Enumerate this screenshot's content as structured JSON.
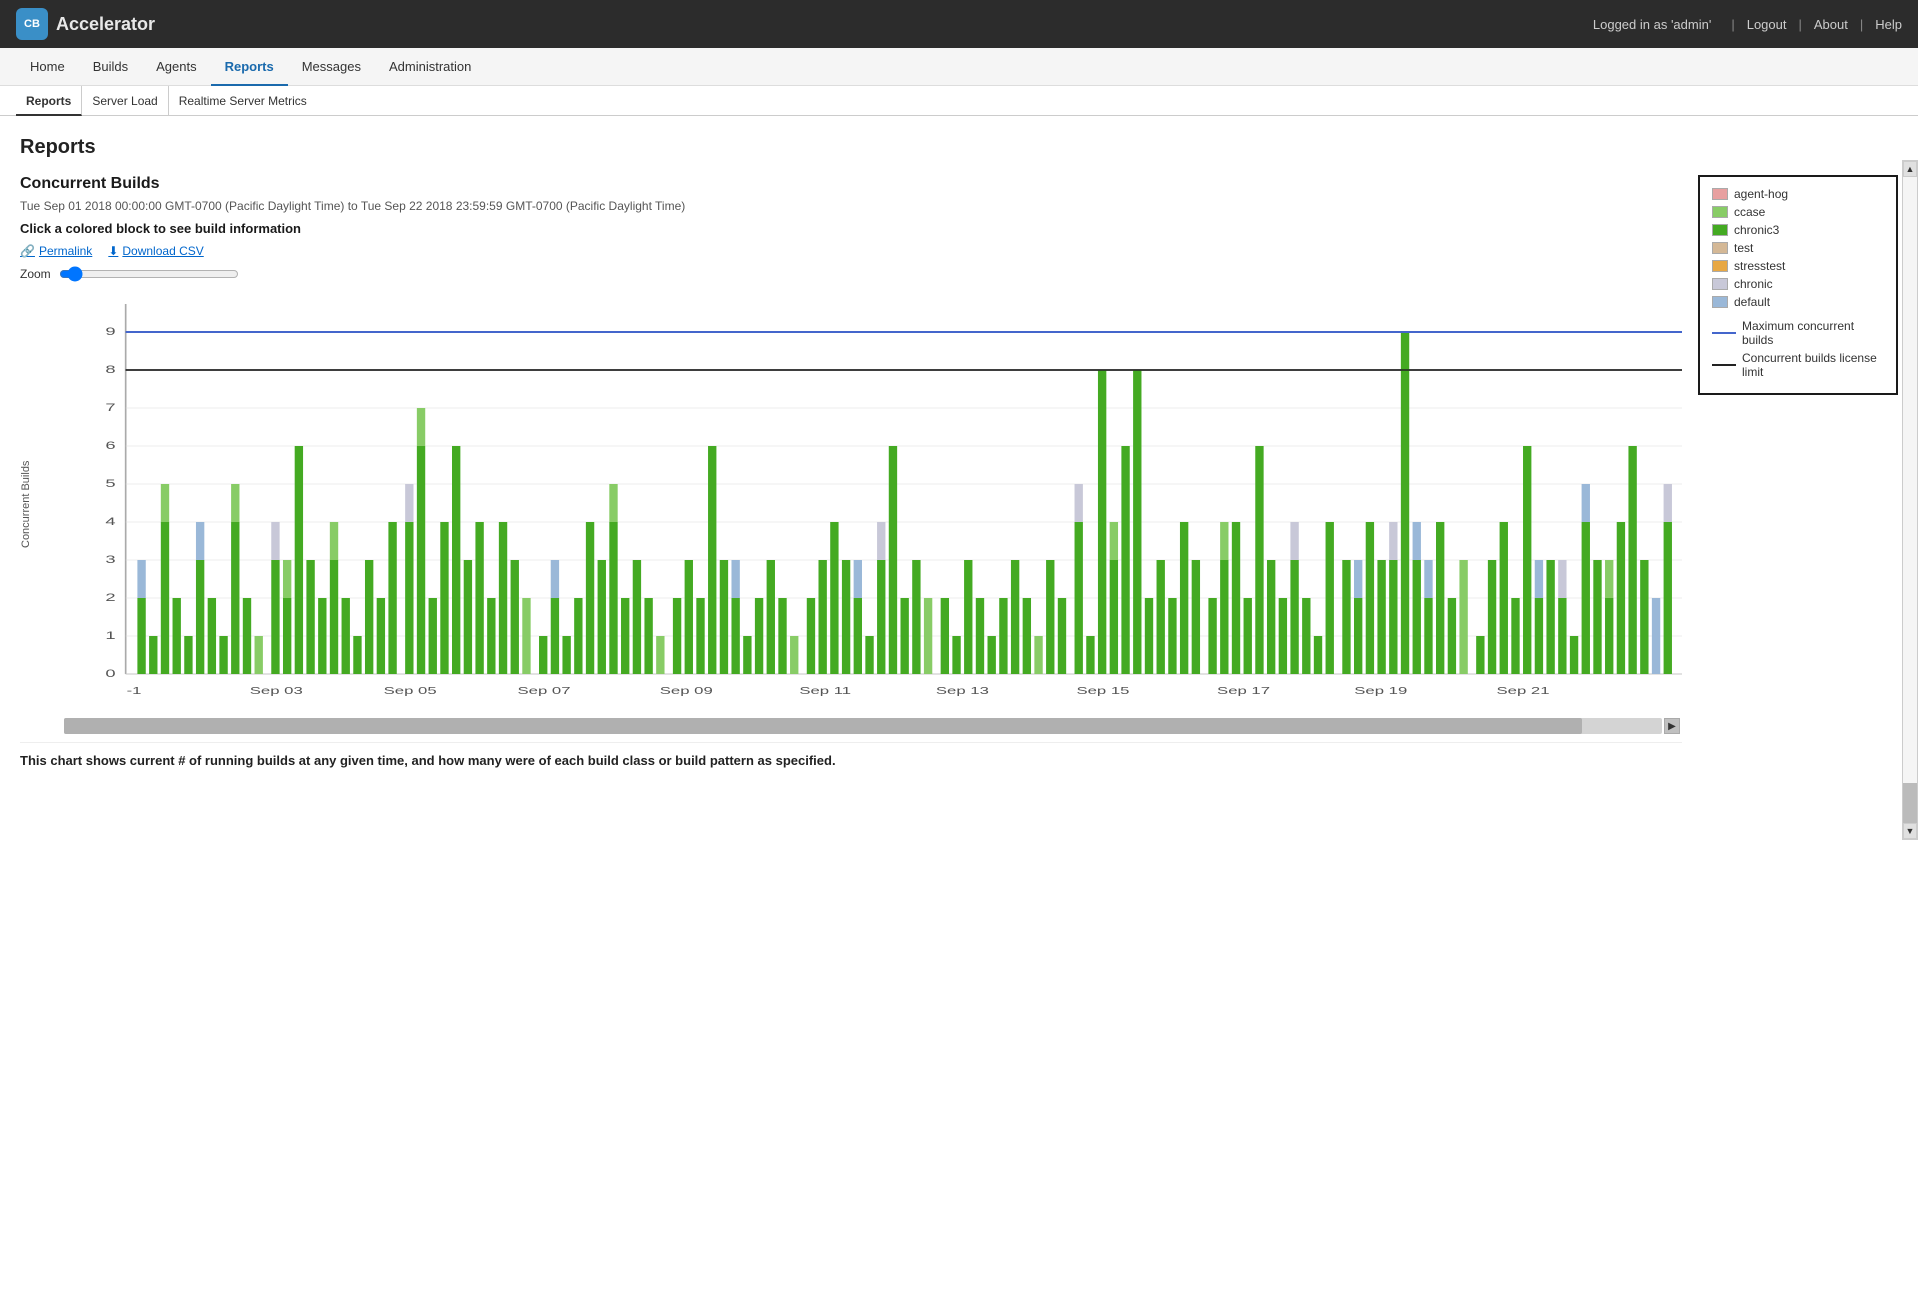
{
  "topbar": {
    "logo_text": "CB",
    "app_name": "Accelerator",
    "logged_in_text": "Logged in as 'admin'",
    "logout_label": "Logout",
    "about_label": "About",
    "help_label": "Help"
  },
  "mainnav": {
    "items": [
      {
        "label": "Home",
        "active": false
      },
      {
        "label": "Builds",
        "active": false
      },
      {
        "label": "Agents",
        "active": false
      },
      {
        "label": "Reports",
        "active": true
      },
      {
        "label": "Messages",
        "active": false
      },
      {
        "label": "Administration",
        "active": false
      }
    ]
  },
  "subnav": {
    "items": [
      {
        "label": "Reports",
        "active": true
      },
      {
        "label": "Server Load",
        "active": false
      },
      {
        "label": "Realtime Server Metrics",
        "active": false
      }
    ]
  },
  "page": {
    "title": "Reports"
  },
  "chart": {
    "title": "Concurrent Builds",
    "range": "Tue Sep 01 2018 00:00:00 GMT-0700 (Pacific Daylight Time) to Tue Sep 22 2018 23:59:59 GMT-0700 (Pacific Daylight Time)",
    "instruction": "Click a colored block to see build information",
    "permalink_label": "Permalink",
    "download_label": "Download CSV",
    "zoom_label": "Zoom",
    "y_axis_label": "Concurrent Builds",
    "note": "This chart shows current # of running builds at any given time, and how many were of each build class or build pattern as specified.",
    "y_ticks": [
      "0",
      "1",
      "2",
      "3",
      "4",
      "5",
      "6",
      "7",
      "8",
      "9"
    ],
    "x_labels": [
      "-1",
      "Sep 03",
      "Sep 05",
      "Sep 07",
      "Sep 09",
      "Sep 11",
      "Sep 13",
      "Sep 15",
      "Sep 17",
      "Sep 19",
      "Sep 21"
    ],
    "legend": {
      "items": [
        {
          "label": "agent-hog",
          "color": "#e8a0a0"
        },
        {
          "label": "ccase",
          "color": "#88cc66"
        },
        {
          "label": "chronic3",
          "color": "#44aa22"
        },
        {
          "label": "test",
          "color": "#d4b896"
        },
        {
          "label": "stresstest",
          "color": "#e8a844"
        },
        {
          "label": "chronic",
          "color": "#c8c8d8"
        },
        {
          "label": "default",
          "color": "#9ab8d8"
        }
      ],
      "lines": [
        {
          "label": "Maximum concurrent builds",
          "color": "#4466cc"
        },
        {
          "label": "Concurrent builds license limit",
          "color": "#222222"
        }
      ]
    }
  }
}
